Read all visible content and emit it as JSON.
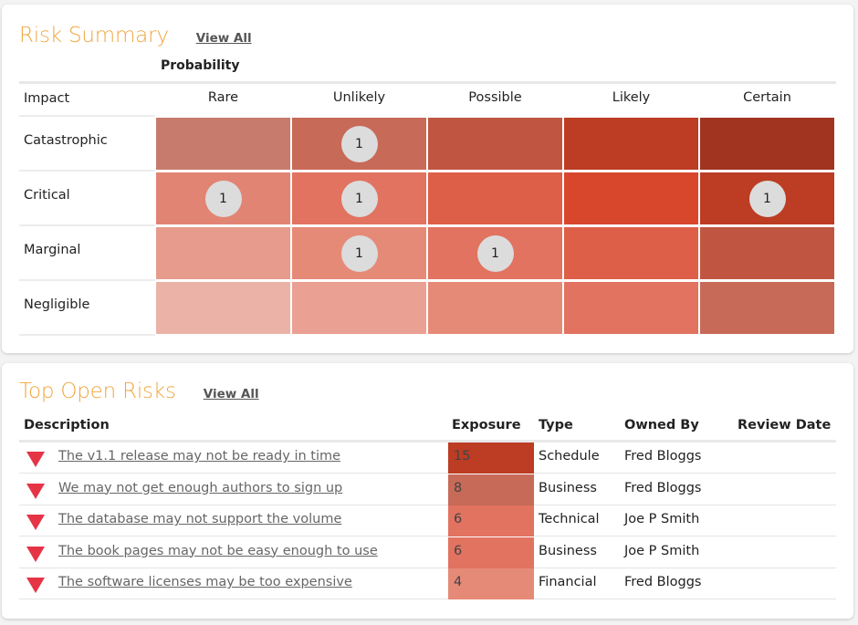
{
  "risk_summary": {
    "title": "Risk Summary",
    "view_all": "View All",
    "probability_label": "Probability",
    "impact_label": "Impact",
    "probability_levels": [
      "Rare",
      "Unlikely",
      "Possible",
      "Likely",
      "Certain"
    ],
    "impact_levels": [
      "Catastrophic",
      "Critical",
      "Marginal",
      "Negligible"
    ],
    "cell_colors": [
      [
        "#c77b6d",
        "#c76a58",
        "#c05641",
        "#bc3c24",
        "#a13421"
      ],
      [
        "#e28473",
        "#e17360",
        "#de5f47",
        "#d8472c",
        "#bc3c24"
      ],
      [
        "#e79b8c",
        "#e68a78",
        "#e17360",
        "#de5f47",
        "#c05641"
      ],
      [
        "#ebb3a8",
        "#eaa092",
        "#e68a78",
        "#e17360",
        "#c76a58"
      ]
    ],
    "counts": [
      [
        null,
        "1",
        null,
        null,
        null
      ],
      [
        "1",
        "1",
        null,
        null,
        "1"
      ],
      [
        null,
        "1",
        "1",
        null,
        null
      ],
      [
        null,
        null,
        null,
        null,
        null
      ]
    ]
  },
  "top_open_risks": {
    "title": "Top Open Risks",
    "view_all": "View All",
    "columns": [
      "Description",
      "Exposure",
      "Type",
      "Owned By",
      "Review Date"
    ],
    "rows": [
      {
        "description": "The v1.1 release may not be ready in time",
        "exposure": "15",
        "exposure_color": "#bc3c24",
        "type": "Schedule",
        "owner": "Fred Bloggs",
        "review_date": ""
      },
      {
        "description": "We may not get enough authors to sign up",
        "exposure": "8",
        "exposure_color": "#c76a58",
        "type": "Business",
        "owner": "Fred Bloggs",
        "review_date": ""
      },
      {
        "description": "The database may not support the volume",
        "exposure": "6",
        "exposure_color": "#e17360",
        "type": "Technical",
        "owner": "Joe P Smith",
        "review_date": ""
      },
      {
        "description": "The book pages may not be easy enough to use",
        "exposure": "6",
        "exposure_color": "#e17360",
        "type": "Business",
        "owner": "Joe P Smith",
        "review_date": ""
      },
      {
        "description": "The software licenses may be too expensive",
        "exposure": "4",
        "exposure_color": "#e68a78",
        "type": "Financial",
        "owner": "Fred Bloggs",
        "review_date": ""
      }
    ],
    "priority_icon": "down-triangle-icon",
    "priority_icon_color": "#e53446"
  },
  "accent_color": "#f0a640"
}
